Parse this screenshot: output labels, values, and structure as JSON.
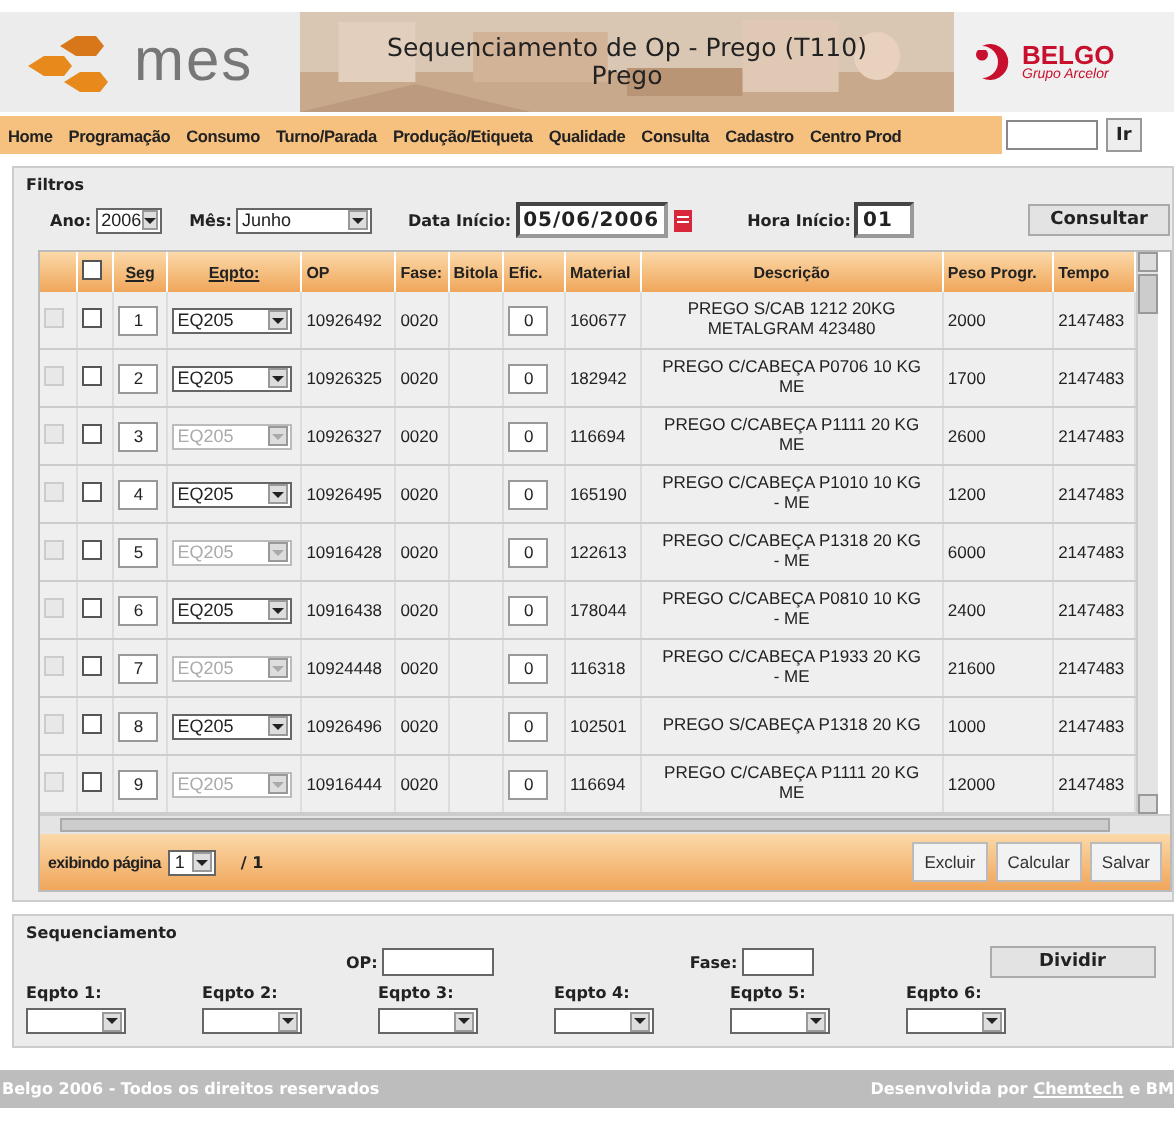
{
  "header": {
    "logo_text": "mes",
    "title": "Sequenciamento de Op - Prego (T110)",
    "subtitle": "Prego",
    "brand": "BELGO",
    "brand_sub": "Grupo Arcelor"
  },
  "menu": {
    "items": [
      "Home",
      "Programação",
      "Consumo",
      "Turno/Parada",
      "Produção/Etiqueta",
      "Qualidade",
      "Consulta",
      "Cadastro",
      "Centro Prod"
    ],
    "go_button": "Ir"
  },
  "filters": {
    "title": "Filtros",
    "year_label": "Ano:",
    "year": "2006",
    "month_label": "Mês:",
    "month": "Junho",
    "start_date_label": "Data Início:",
    "start_date": "05/06/2006",
    "start_hour_label": "Hora Início:",
    "start_hour": "01",
    "query_button": "Consultar"
  },
  "table": {
    "all_checked": false,
    "columns": [
      "Seg",
      "Eqpto:",
      "OP",
      "Fase:",
      "Bitola",
      "Efic.",
      "Material",
      "Descrição",
      "Peso Progr.",
      "Tempo"
    ],
    "rows": [
      {
        "flag_checked": false,
        "flag_disabled": true,
        "checked": false,
        "seg": "1",
        "eqpto": "EQ205",
        "disabled": false,
        "op": "10926492",
        "fase": "0020",
        "efic": "0",
        "material": "160677",
        "descricao": "PREGO S/CAB 1212 20KG METALGRAM 423480",
        "peso": "2000",
        "tempo": "2147483"
      },
      {
        "flag_checked": false,
        "flag_disabled": true,
        "checked": false,
        "seg": "2",
        "eqpto": "EQ205",
        "disabled": false,
        "op": "10926325",
        "fase": "0020",
        "efic": "0",
        "material": "182942",
        "descricao": "PREGO C/CABEÇA P0706 10 KG ME",
        "peso": "1700",
        "tempo": "2147483"
      },
      {
        "flag_checked": false,
        "flag_disabled": true,
        "checked": false,
        "seg": "3",
        "eqpto": "EQ205",
        "disabled": true,
        "op": "10926327",
        "fase": "0020",
        "efic": "0",
        "material": "116694",
        "descricao": "PREGO C/CABEÇA P1111 20 KG ME",
        "peso": "2600",
        "tempo": "2147483"
      },
      {
        "flag_checked": false,
        "flag_disabled": true,
        "checked": false,
        "seg": "4",
        "eqpto": "EQ205",
        "disabled": false,
        "op": "10926495",
        "fase": "0020",
        "efic": "0",
        "material": "165190",
        "descricao": "PREGO C/CABEÇA P1010 10 KG - ME",
        "peso": "1200",
        "tempo": "2147483"
      },
      {
        "flag_checked": false,
        "flag_disabled": true,
        "checked": false,
        "seg": "5",
        "eqpto": "EQ205",
        "disabled": true,
        "op": "10916428",
        "fase": "0020",
        "efic": "0",
        "material": "122613",
        "descricao": "PREGO C/CABEÇA P1318 20 KG - ME",
        "peso": "6000",
        "tempo": "2147483"
      },
      {
        "flag_checked": false,
        "flag_disabled": true,
        "checked": false,
        "seg": "6",
        "eqpto": "EQ205",
        "disabled": false,
        "op": "10916438",
        "fase": "0020",
        "efic": "0",
        "material": "178044",
        "descricao": "PREGO C/CABEÇA P0810 10 KG - ME",
        "peso": "2400",
        "tempo": "2147483"
      },
      {
        "flag_checked": false,
        "flag_disabled": true,
        "checked": false,
        "seg": "7",
        "eqpto": "EQ205",
        "disabled": true,
        "op": "10924448",
        "fase": "0020",
        "efic": "0",
        "material": "116318",
        "descricao": "PREGO C/CABEÇA P1933 20 KG - ME",
        "peso": "21600",
        "tempo": "2147483"
      },
      {
        "flag_checked": false,
        "flag_disabled": true,
        "checked": false,
        "seg": "8",
        "eqpto": "EQ205",
        "disabled": false,
        "op": "10926496",
        "fase": "0020",
        "efic": "0",
        "material": "102501",
        "descricao": "PREGO S/CABEÇA P1318 20 KG",
        "peso": "1000",
        "tempo": "2147483"
      },
      {
        "flag_checked": false,
        "flag_disabled": true,
        "checked": false,
        "seg": "9",
        "eqpto": "EQ205",
        "disabled": true,
        "op": "10916444",
        "fase": "0020",
        "efic": "0",
        "material": "116694",
        "descricao": "PREGO C/CABEÇA P1111 20 KG ME",
        "peso": "12000",
        "tempo": "2147483"
      }
    ],
    "pager_label": "exibindo página",
    "page": "1",
    "page_total": "/ 1",
    "buttons": [
      "Excluir",
      "Calcular",
      "Salvar"
    ]
  },
  "sequencing": {
    "title": "Sequenciamento",
    "op_label": "OP:",
    "fase_label": "Fase:",
    "split_button": "Dividir",
    "equipment_labels": [
      "Eqpto 1:",
      "Eqpto 2:",
      "Eqpto 3:",
      "Eqpto 4:",
      "Eqpto 5:",
      "Eqpto 6:"
    ]
  },
  "footer": {
    "copyright": "Belgo 2006 - Todos os direitos reservados",
    "credit": "Desenvolvida por",
    "credit_link": "Chemtech",
    "credit_rest": "e BM"
  }
}
